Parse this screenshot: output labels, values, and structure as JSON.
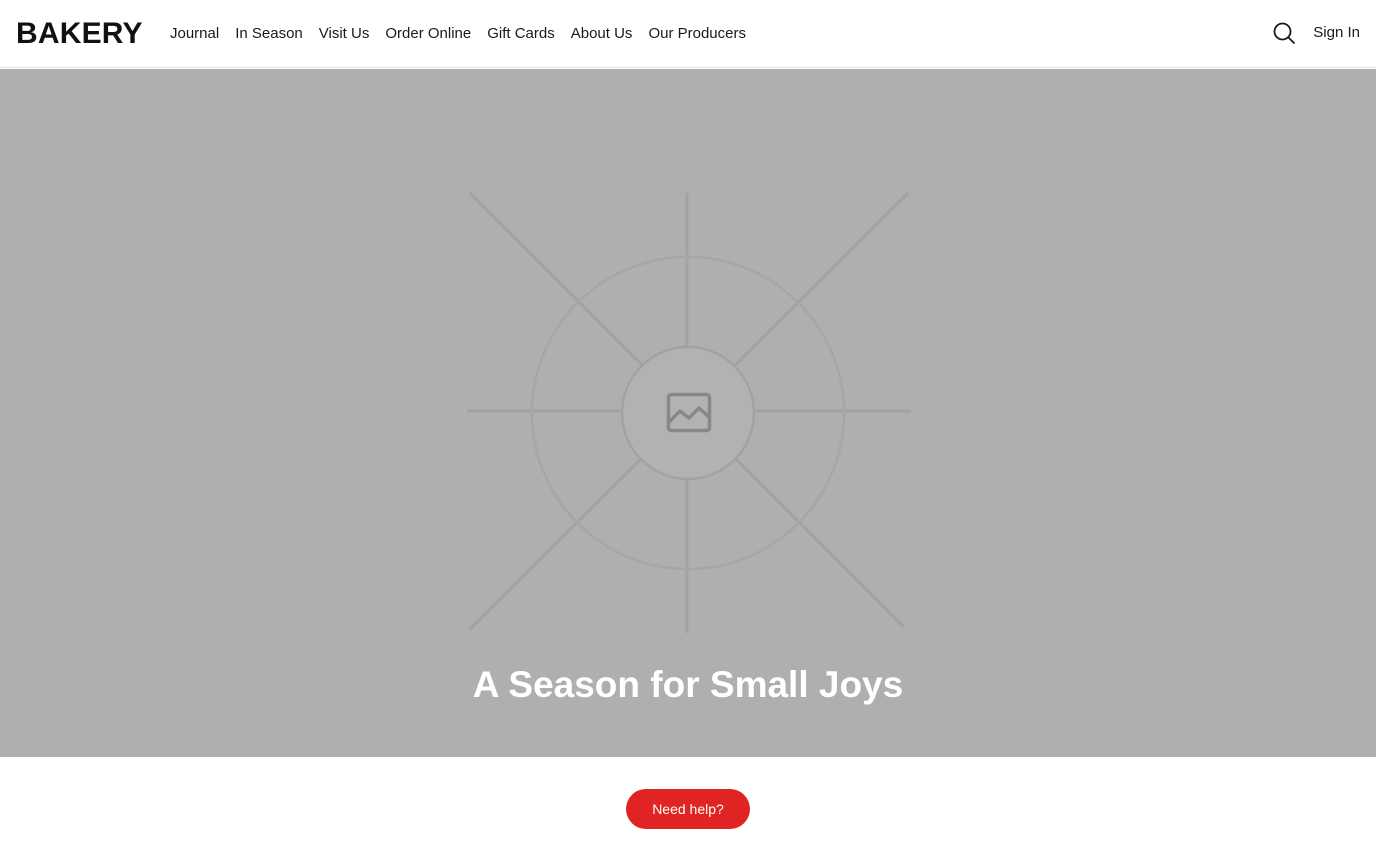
{
  "header": {
    "logo": "BAKERY",
    "nav": [
      {
        "label": "Journal"
      },
      {
        "label": "In Season"
      },
      {
        "label": "Visit Us"
      },
      {
        "label": "Order Online"
      },
      {
        "label": "Gift Cards"
      },
      {
        "label": "About Us"
      },
      {
        "label": "Our Producers"
      }
    ],
    "search_icon": "search-icon",
    "sign_in": "Sign In"
  },
  "hero": {
    "background_color": "#afafaf",
    "placeholder_icon": "image-icon",
    "title": "A Season for Small Joys"
  },
  "help": {
    "label": "Need help?",
    "color": "#e02424"
  }
}
